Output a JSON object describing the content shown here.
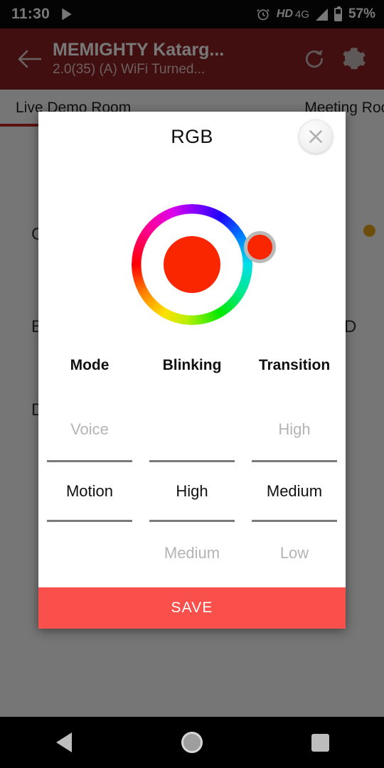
{
  "status_bar": {
    "clock": "11:30",
    "play_icon": "play-store-icon",
    "alarm_icon": "alarm-icon",
    "hd_label": "HD",
    "network_label": "4G",
    "signal_icon": "signal-bars-icon",
    "battery_icon": "battery-icon",
    "battery_percent": "57%"
  },
  "app_bar": {
    "back_icon": "back-arrow-icon",
    "title": "MEMIGHTY Katarg...",
    "subtitle": "2.0(35) (A) WiFi Turned...",
    "refresh_icon": "refresh-icon",
    "settings_icon": "gear-icon",
    "bar_color": "#8d2026"
  },
  "tabs": [
    {
      "label": "Live Demo Room",
      "selected": true
    },
    {
      "label": "Meeting Roo",
      "selected": false
    }
  ],
  "background_page": {
    "partial_labels": [
      "C",
      "B",
      "DI",
      "D"
    ],
    "indicator_dot_color": "#e8a317"
  },
  "dialog": {
    "title": "RGB",
    "close_icon": "close-icon",
    "color_wheel": {
      "name": "hue-color-wheel",
      "selected_color": "#fa2600",
      "thumb_color": "#fa2600",
      "thumb_ring_color": "#b9b9b9"
    },
    "pickers": [
      {
        "header": "Mode",
        "above": "Voice",
        "selected": "Motion",
        "below": ""
      },
      {
        "header": "Blinking",
        "above": "",
        "selected": "High",
        "below": "Medium"
      },
      {
        "header": "Transition",
        "above": "High",
        "selected": "Medium",
        "below": "Low"
      }
    ],
    "save_label": "SAVE",
    "save_color": "#f9504c"
  },
  "nav_bar": {
    "back_icon": "nav-back-icon",
    "home_icon": "nav-home-icon",
    "recents_icon": "nav-recents-icon"
  }
}
